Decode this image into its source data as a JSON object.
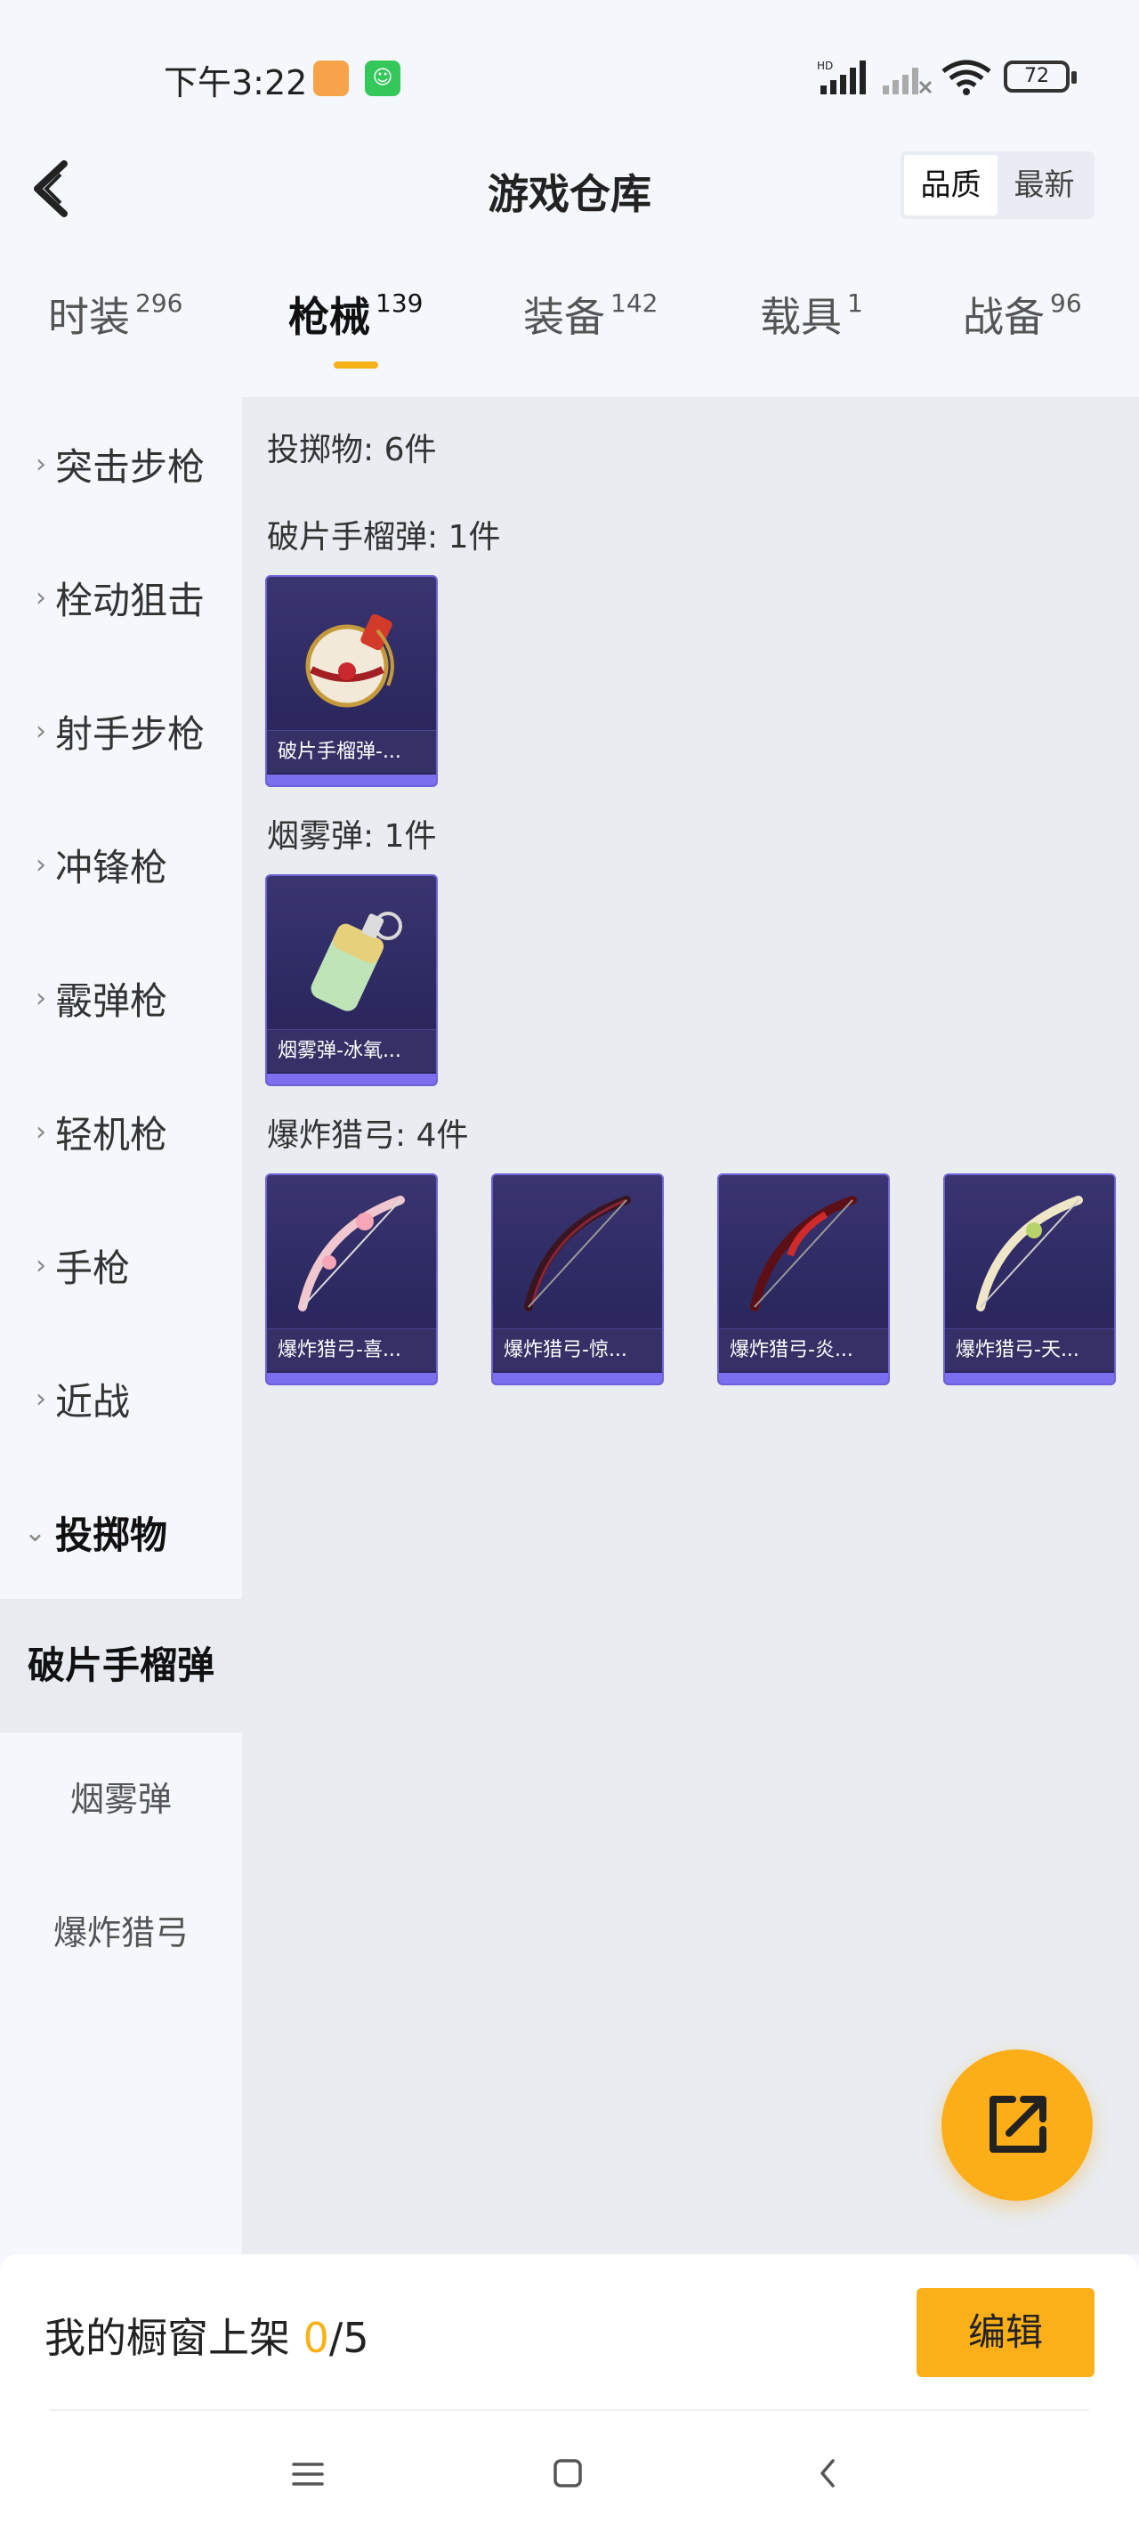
{
  "status_bar": {
    "time": "下午3:22",
    "battery": "72",
    "icons": [
      "app-icon-1",
      "app-icon-2",
      "hd-signal-icon",
      "no-signal-icon",
      "wifi-icon",
      "battery-icon"
    ]
  },
  "header": {
    "title": "游戏仓库",
    "sort_options": [
      "品质",
      "最新"
    ],
    "sort_active": "品质"
  },
  "tabs": [
    {
      "label": "时装",
      "count": "296"
    },
    {
      "label": "枪械",
      "count": "139"
    },
    {
      "label": "装备",
      "count": "142"
    },
    {
      "label": "载具",
      "count": "1"
    },
    {
      "label": "战备",
      "count": "96"
    }
  ],
  "active_tab": "枪械",
  "sidebar": {
    "categories": [
      {
        "label": "突击步枪"
      },
      {
        "label": "栓动狙击"
      },
      {
        "label": "射手步枪"
      },
      {
        "label": "冲锋枪"
      },
      {
        "label": "霰弹枪"
      },
      {
        "label": "轻机枪"
      },
      {
        "label": "手枪"
      },
      {
        "label": "近战"
      },
      {
        "label": "投掷物"
      }
    ],
    "subcategories": [
      {
        "label": "破片手榴弹"
      },
      {
        "label": "烟雾弹"
      },
      {
        "label": "爆炸猎弓"
      }
    ],
    "active_subcategory": "破片手榴弹"
  },
  "content": {
    "summary": "投掷物: 6件",
    "sections": [
      {
        "title": "破片手榴弹: 1件",
        "items": [
          {
            "name": "破片手榴弹-..."
          }
        ]
      },
      {
        "title": "烟雾弹: 1件",
        "items": [
          {
            "name": "烟雾弹-冰氧..."
          }
        ]
      },
      {
        "title": "爆炸猎弓: 4件",
        "items": [
          {
            "name": "爆炸猎弓-喜..."
          },
          {
            "name": "爆炸猎弓-惊..."
          },
          {
            "name": "爆炸猎弓-炎..."
          },
          {
            "name": "爆炸猎弓-天..."
          }
        ]
      }
    ]
  },
  "bottom": {
    "shelf_label": "我的橱窗上架",
    "shelf_used": "0",
    "shelf_total": "/5",
    "edit_label": "编辑"
  },
  "colors": {
    "accent": "#f7b21a",
    "card_bg": "#2c2860",
    "card_border": "#6d62d6"
  }
}
